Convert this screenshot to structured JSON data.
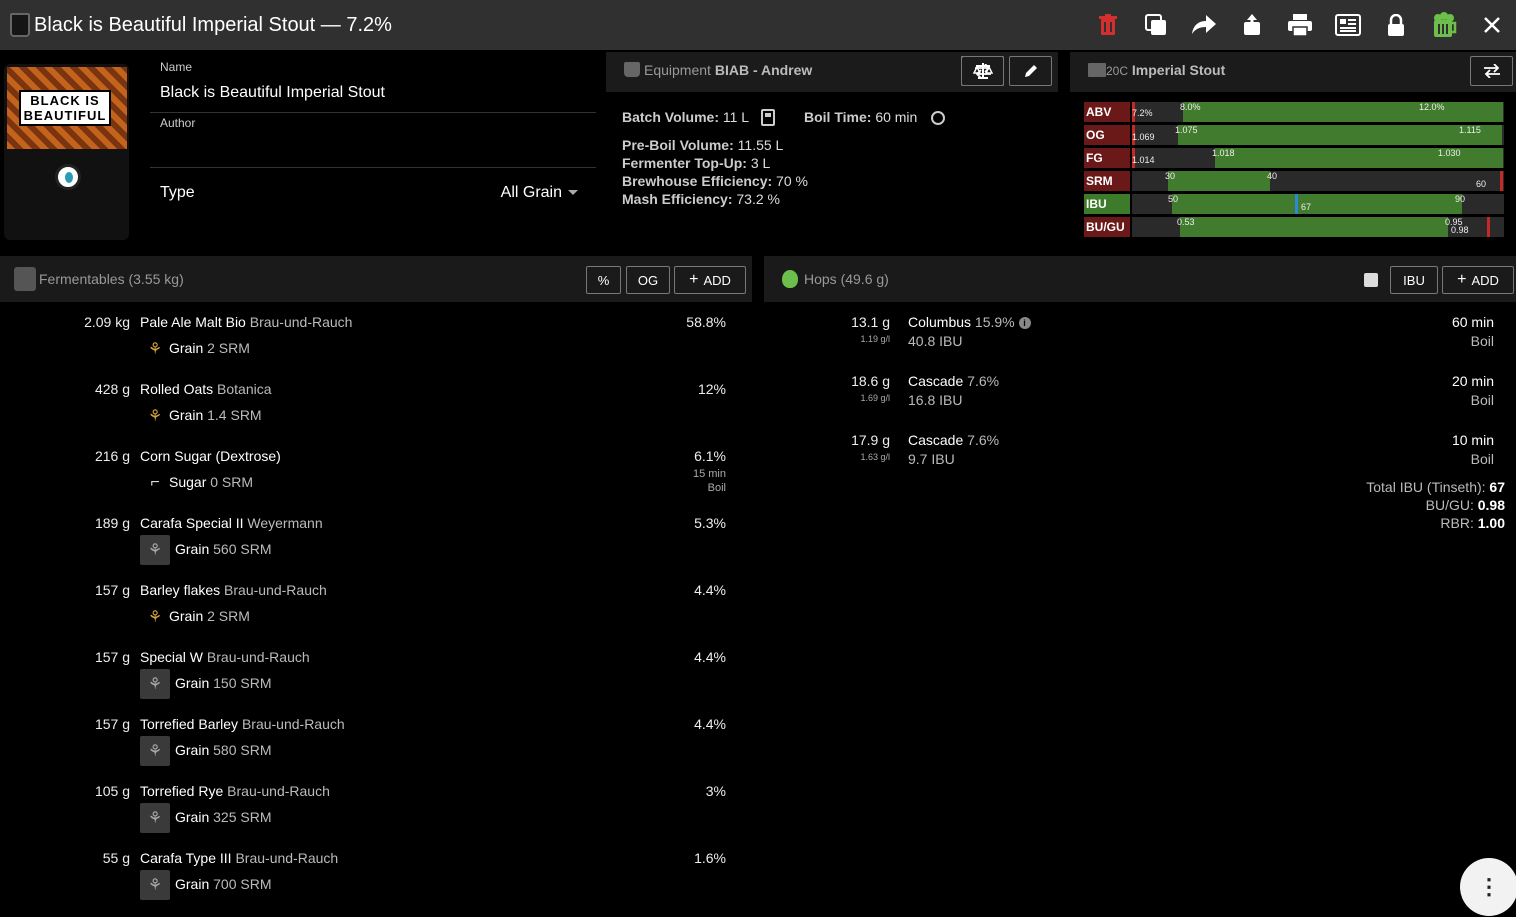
{
  "window": {
    "title": "Black is Beautiful Imperial Stout — 7.2%",
    "toolbar_icons": [
      "trash-icon",
      "copy-icon",
      "share-icon",
      "export-icon",
      "print-icon",
      "brew-sheet-icon",
      "lock-icon",
      "brew-icon",
      "close-icon"
    ]
  },
  "label": {
    "line1": "BLACK IS",
    "line2": "BEAUTIFUL"
  },
  "recipe": {
    "name_label": "Name",
    "name": "Black is Beautiful Imperial Stout",
    "author_label": "Author",
    "author": "",
    "type_label": "Type",
    "type": "All Grain"
  },
  "equipment": {
    "title_prefix": "Equipment",
    "name": "BIAB - Andrew",
    "batch_volume_label": "Batch Volume:",
    "batch_volume": "11 L",
    "boil_time_label": "Boil Time:",
    "boil_time": "60 min",
    "preboil_label": "Pre-Boil Volume:",
    "preboil": "11.55 L",
    "topup_label": "Fermenter Top-Up:",
    "topup": "3 L",
    "brewhouse_label": "Brewhouse Efficiency:",
    "brewhouse": "70 %",
    "mash_label": "Mash Efficiency:",
    "mash": "73.2 %"
  },
  "style": {
    "code": "20C",
    "name": "Imperial Stout",
    "stats": [
      {
        "name": "ABV",
        "value": "7.2%",
        "min": "8.0%",
        "max": "12.0%",
        "in_range": false
      },
      {
        "name": "OG",
        "value": "1.069",
        "min": "1.075",
        "max": "1.115",
        "in_range": false
      },
      {
        "name": "FG",
        "value": "1.014",
        "min": "1.018",
        "max": "1.030",
        "in_range": false
      },
      {
        "name": "SRM",
        "value": "60",
        "min": "30",
        "max": "40",
        "in_range": false
      },
      {
        "name": "IBU",
        "value": "67",
        "min": "50",
        "max": "90",
        "in_range": true
      },
      {
        "name": "BU/GU",
        "value": "0.98",
        "min": "0.53",
        "max": "0.95",
        "in_range": false
      }
    ]
  },
  "fermentables": {
    "title": "Fermentables (3.55 kg)",
    "buttons": {
      "pct": "%",
      "og": "OG",
      "add": "ADD"
    },
    "items": [
      {
        "amount": "2.09 kg",
        "name": "Pale Ale Malt Bio",
        "supplier": "Brau-und-Rauch",
        "type": "Grain",
        "color": "2 SRM",
        "pct": "58.8%",
        "icon": "wheat-icon",
        "dark": false
      },
      {
        "amount": "428 g",
        "name": "Rolled Oats",
        "supplier": "Botanica",
        "type": "Grain",
        "color": "1.4 SRM",
        "pct": "12%",
        "icon": "wheat-icon",
        "dark": false
      },
      {
        "amount": "216 g",
        "name": "Corn Sugar (Dextrose)",
        "supplier": "",
        "type": "Sugar",
        "color": "0 SRM",
        "pct": "6.1%",
        "icon": "candy-cane-icon",
        "dark": false,
        "time": "15 min",
        "use": "Boil"
      },
      {
        "amount": "189 g",
        "name": "Carafa Special II",
        "supplier": "Weyermann",
        "type": "Grain",
        "color": "560 SRM",
        "pct": "5.3%",
        "icon": "wheat-icon",
        "dark": true
      },
      {
        "amount": "157 g",
        "name": "Barley flakes",
        "supplier": "Brau-und-Rauch",
        "type": "Grain",
        "color": "2 SRM",
        "pct": "4.4%",
        "icon": "wheat-icon",
        "dark": false
      },
      {
        "amount": "157 g",
        "name": "Special W",
        "supplier": "Brau-und-Rauch",
        "type": "Grain",
        "color": "150 SRM",
        "pct": "4.4%",
        "icon": "wheat-icon",
        "dark": true
      },
      {
        "amount": "157 g",
        "name": "Torrefied Barley",
        "supplier": "Brau-und-Rauch",
        "type": "Grain",
        "color": "580 SRM",
        "pct": "4.4%",
        "icon": "wheat-icon",
        "dark": true
      },
      {
        "amount": "105 g",
        "name": "Torrefied Rye",
        "supplier": "Brau-und-Rauch",
        "type": "Grain",
        "color": "325 SRM",
        "pct": "3%",
        "icon": "wheat-icon",
        "dark": true
      },
      {
        "amount": "55 g",
        "name": "Carafa Type III",
        "supplier": "Brau-und-Rauch",
        "type": "Grain",
        "color": "700 SRM",
        "pct": "1.6%",
        "icon": "wheat-icon",
        "dark": true
      }
    ]
  },
  "hops": {
    "title": "Hops (49.6 g)",
    "buttons": {
      "ibu": "IBU",
      "add": "ADD"
    },
    "items": [
      {
        "amount": "13.1 g",
        "rate": "1.19 g/l",
        "name": "Columbus",
        "alpha": "15.9%",
        "ibu": "40.8 IBU",
        "time": "60 min",
        "use": "Boil",
        "info": true
      },
      {
        "amount": "18.6 g",
        "rate": "1.69 g/l",
        "name": "Cascade",
        "alpha": "7.6%",
        "ibu": "16.8 IBU",
        "time": "20 min",
        "use": "Boil",
        "info": false
      },
      {
        "amount": "17.9 g",
        "rate": "1.63 g/l",
        "name": "Cascade",
        "alpha": "7.6%",
        "ibu": "9.7 IBU",
        "time": "10 min",
        "use": "Boil",
        "info": false
      }
    ],
    "total_ibu_label": "Total IBU (Tinseth):",
    "total_ibu": "67",
    "bugu_label": "BU/GU:",
    "bugu": "0.98",
    "rbr_label": "RBR:",
    "rbr": "1.00"
  },
  "colors": {
    "accent_green": "#417b2e",
    "out_of_range": "#6a1818",
    "marker_red": "#c62828",
    "marker_blue": "#2a8ad4"
  }
}
